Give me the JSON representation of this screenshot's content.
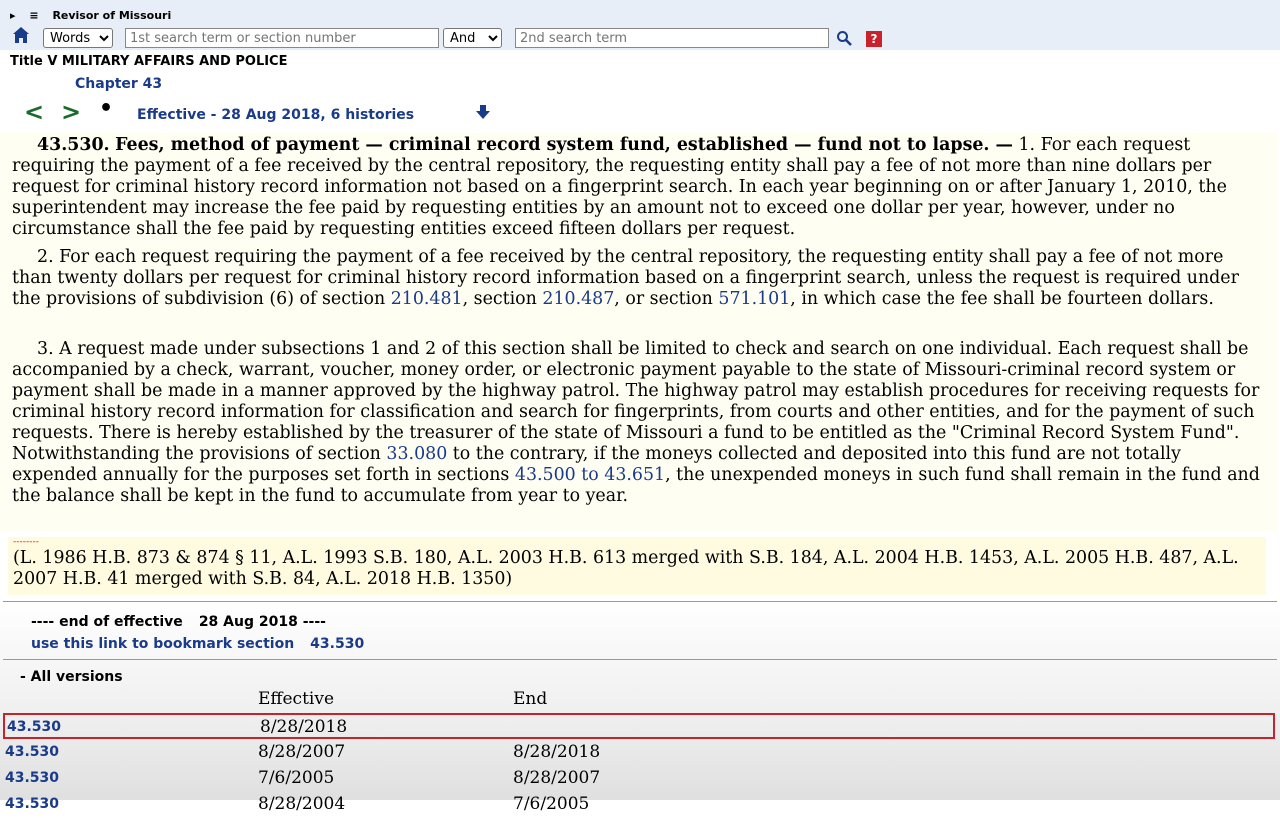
{
  "site": {
    "title": "Revisor of Missouri"
  },
  "search": {
    "mode": "Words",
    "term1_placeholder": "1st search term or section number",
    "bool": "And",
    "term2_placeholder": "2nd search term",
    "help_label": "?"
  },
  "nav": {
    "title": "Title V MILITARY AFFAIRS AND POLICE",
    "chapter": "Chapter 43",
    "prev": "<",
    "next": ">",
    "dot": "•",
    "effective": "Effective - 28 Aug 2018, 6 histories"
  },
  "statute": {
    "section": "43.530.",
    "heading": "Fees, method of payment — criminal record system fund, established — fund not to lapse. —",
    "p1_text": " 1.  For each request requiring the payment of a fee received by the central repository, the requesting entity shall pay a fee of not more than nine dollars per request for criminal history record information not based on a fingerprint search.  In each year beginning on or after January 1, 2010, the superintendent may increase the fee paid by requesting entities by an amount not to exceed one dollar per year, however, under no circumstance shall the fee paid by requesting entities exceed fifteen dollars per request.",
    "p2_a": "2.  For each request requiring the payment of a fee received by the central repository, the requesting entity shall pay a fee of not more than twenty dollars per request for criminal history record information based on a fingerprint search, unless the request is required under the provisions of subdivision (6) of section ",
    "p2_link1": "210.481",
    "p2_b": ", section ",
    "p2_link2": "210.487",
    "p2_c": ", or section ",
    "p2_link3": "571.101",
    "p2_d": ", in which case the fee shall be fourteen dollars.",
    "p3_a": "3.  A request made under subsections 1 and 2 of this section shall be limited to check and search on one individual.  Each request shall be accompanied by a check, warrant, voucher, money order, or electronic payment payable to the state of Missouri-criminal record system or payment shall be made in a manner approved by the highway patrol.  The highway patrol may establish procedures for receiving requests for criminal history record information for classification and search for fingerprints, from courts and other entities, and for the payment of such requests.  There is hereby established by the treasurer of the state of Missouri a fund to be entitled as the \"Criminal Record System Fund\".  Notwithstanding the provisions of section ",
    "p3_link1": "33.080",
    "p3_b": " to the contrary, if the moneys collected and deposited into this fund are not totally expended annually for the purposes set forth in sections ",
    "p3_link2": "43.500 to 43.651",
    "p3_c": ", the unexpended moneys in such fund shall remain in the fund and the balance shall be kept in the fund to accumulate from year to year."
  },
  "history": {
    "dashes": "--------",
    "text": "(L. 1986 H.B. 873 & 874 § 11, A.L. 1993 S.B. 180, A.L. 2003 H.B. 613 merged with S.B. 184, A.L. 2004 H.B. 1453, A.L. 2005 H.B. 487, A.L. 2007 H.B. 41 merged with S.B. 84, A.L. 2018 H.B. 1350)"
  },
  "footer": {
    "end_label": "---- end of effective",
    "end_date": "28 Aug 2018 ----",
    "bookmark_label": "use this link to bookmark section",
    "bookmark_section": "43.530"
  },
  "versions": {
    "heading": "- All versions",
    "col_effective": "Effective",
    "col_end": "End",
    "rows": [
      {
        "section": "43.530",
        "effective": "8/28/2018",
        "end": ""
      },
      {
        "section": "43.530",
        "effective": "8/28/2007",
        "end": "8/28/2018"
      },
      {
        "section": "43.530",
        "effective": "7/6/2005",
        "end": "8/28/2007"
      },
      {
        "section": "43.530",
        "effective": "8/28/2004",
        "end": "7/6/2005"
      }
    ]
  },
  "colors": {
    "link": "#1a3a8a",
    "nav_arrow": "#1a6b2a",
    "highlight": "#c8232c",
    "statute_bg": "#fffef2"
  }
}
